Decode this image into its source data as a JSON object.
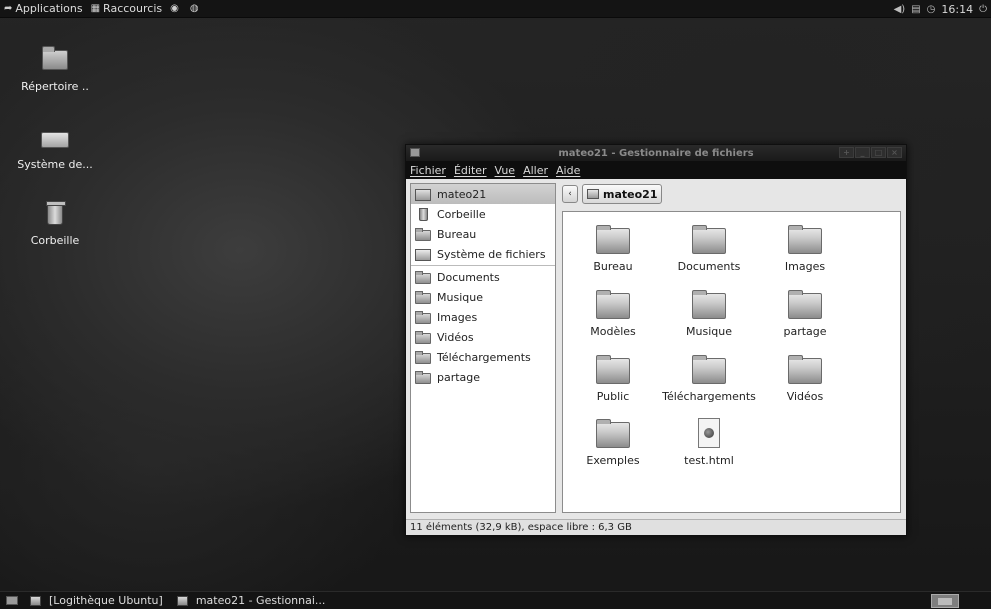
{
  "top_panel": {
    "applications_label": "Applications",
    "places_label": "Raccourcis",
    "clock": "16:14"
  },
  "desktop_icons": [
    {
      "label": "Répertoire .."
    },
    {
      "label": "Système de..."
    },
    {
      "label": "Corbeille"
    }
  ],
  "window": {
    "title": "mateo21 - Gestionnaire de fichiers",
    "menu": {
      "file": "Fichier",
      "edit": "Éditer",
      "view": "Vue",
      "go": "Aller",
      "help": "Aide"
    },
    "sidebar": {
      "places": [
        {
          "label": "mateo21",
          "icon": "home-icon"
        },
        {
          "label": "Corbeille",
          "icon": "trash-icon"
        },
        {
          "label": "Bureau",
          "icon": "folder-icon"
        },
        {
          "label": "Système de fichiers",
          "icon": "drive-icon"
        }
      ],
      "bookmarks": [
        {
          "label": "Documents"
        },
        {
          "label": "Musique"
        },
        {
          "label": "Images"
        },
        {
          "label": "Vidéos"
        },
        {
          "label": "Téléchargements"
        },
        {
          "label": "partage"
        }
      ]
    },
    "pathbar": {
      "back_glyph": "‹",
      "current": "mateo21"
    },
    "files": [
      {
        "name": "Bureau",
        "type": "folder"
      },
      {
        "name": "Documents",
        "type": "folder"
      },
      {
        "name": "Images",
        "type": "folder"
      },
      {
        "name": "Modèles",
        "type": "folder"
      },
      {
        "name": "Musique",
        "type": "folder"
      },
      {
        "name": "partage",
        "type": "folder"
      },
      {
        "name": "Public",
        "type": "folder"
      },
      {
        "name": "Téléchargements",
        "type": "folder"
      },
      {
        "name": "Vidéos",
        "type": "folder"
      },
      {
        "name": "Exemples",
        "type": "folder"
      },
      {
        "name": "test.html",
        "type": "html-file"
      }
    ],
    "status": "11 éléments (32,9 kB), espace libre : 6,3 GB"
  },
  "bottom_panel": {
    "tasks": [
      {
        "label": "[Logithèque Ubuntu]"
      },
      {
        "label": "mateo21 - Gestionnai..."
      }
    ]
  }
}
